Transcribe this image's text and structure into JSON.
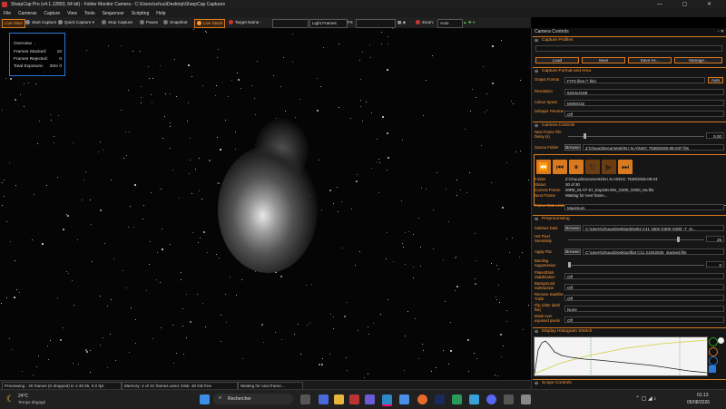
{
  "window": {
    "title": "SharpCap Pro (v4.1.12893, 64 bit) - Folder Monitor Camera - C:\\Users\\schuu\\Desktop\\SharpCap Captures",
    "controls": "—  ▢  ✕"
  },
  "menu": [
    "File",
    "Cameras",
    "Capture",
    "View",
    "Tools",
    "Sequencer",
    "Scripting",
    "Help"
  ],
  "toolbar": {
    "live_view": "Live View",
    "start_capture": "Start Capture",
    "quick_capture": "Quick Capture",
    "stop_capture": "Stop Capture",
    "pause": "Pause",
    "snapshot": "Snapshot",
    "live_stack": "Live Stack",
    "target_name": "Target Name :",
    "light_frames": "Light Frames",
    "fx": "FX",
    "zoom_label": "Zoom:",
    "zoom_value": "Auto"
  },
  "overview": {
    "title": "Overview",
    "rows": [
      {
        "label": "Frames Stacked:",
        "value": "10"
      },
      {
        "label": "Frames Rejected:",
        "value": "0"
      },
      {
        "label": "Total Exposure:",
        "value": "30m 0"
      }
    ]
  },
  "status": {
    "left": "Previewing : 30 frames (0 dropped) in 1:49:25, 0.0 fps",
    "memory": "Memory: 4 of 41 frames used. Disk: 49 GB free",
    "waiting": "Waiting for next frame..."
  },
  "panel": {
    "title": "Camera Controls",
    "capture_profiles": {
      "header": "Capture Profiles",
      "buttons": [
        "Load",
        "Save",
        "Save As...",
        "Manage..."
      ]
    },
    "format_area": {
      "header": "Capture Format and Area",
      "output_format_label": "Output Format",
      "output_format": "FITS files (*.fits)",
      "auto": "Auto",
      "resolution_label": "Resolution",
      "resolution": "6224x4168",
      "colour_space_label": "Colour Space",
      "colour_space": "MONO16",
      "debayer_label": "Debayer Preview",
      "debayer": "Off"
    },
    "camera_controls": {
      "header": "Camera Controls",
      "new_frame_label": "New Frame File Delay (s)",
      "new_frame_value": "5.00",
      "source_label": "Source Folder",
      "browse": "Browse",
      "source_path": "Z:\\chuuu\\Documents\\N.I.N.A\\NGC 7538\\2026-08-04\\*.fits",
      "folder_label": "Folder",
      "folder": "Z:\\chuuu\\Documents\\N.I.N.A\\NGC 7538\\2026-08-04",
      "status_label": "Status",
      "status": "30 of 30",
      "current_label": "Current Frame",
      "current": "00R8_01-07-57_Exp180.00s_G300_O300_Ha.fits",
      "next_label": "Next Frame",
      "next": "Waiting for next frame...",
      "rate_label": "Frame Rate Limit",
      "rate": "Maximum"
    },
    "preprocessing": {
      "header": "Preprocessing",
      "dark_label": "Subtract Dark",
      "dark_path": "C:\\Users\\chuuu\\Desktop\\Darks C11 180s G300 O300 -7_st...",
      "hot_label": "Hot Pixel Sensitivity",
      "hot_value": "25",
      "flat_label": "Apply Flat",
      "flat_path": "C:\\Users\\chuuu\\Desktop\\flat C11 21042026_stacked.fits",
      "banding_label": "Banding Suppression",
      "banding_value": "0",
      "planet_label": "Planet/Disk Stabilization",
      "planet": "Off",
      "bg_label": "Background Subtraction",
      "bg": "Off",
      "sat_label": "Remove Satellite Trails",
      "sat": "Off",
      "flip_label": "Flip (after dark/ flat)",
      "flip": "None",
      "mask_label": "Mask over exposed pixels",
      "mask": "Off"
    },
    "histogram": {
      "header": "Display Histogram Stretch"
    },
    "scope": {
      "header": "Scope Controls"
    }
  },
  "taskbar": {
    "temp": "24°C",
    "weather": "Temps dégagé",
    "search": "Rechercher",
    "time": "01:13",
    "date": "05/08/2026"
  }
}
